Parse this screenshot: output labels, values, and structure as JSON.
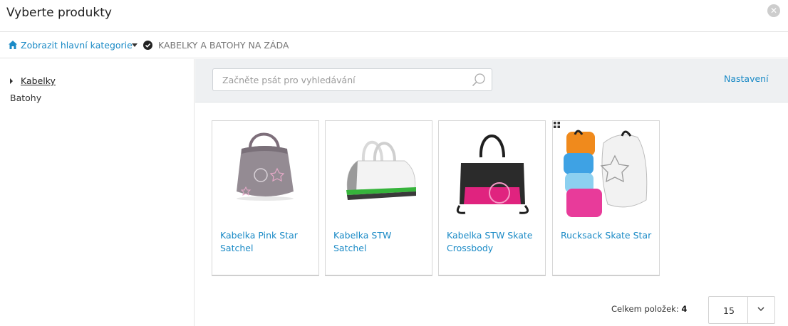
{
  "dialog": {
    "title": "Vyberte produkty",
    "close_icon": "close-icon"
  },
  "breadcrumb": {
    "home_icon": "home-icon",
    "link_label": "Zobrazit hlavní kategorie",
    "caret_icon": "caret-down-icon",
    "check_icon": "check-circle-icon",
    "current": "KABELKY A BATOHY NA ZÁDA"
  },
  "sidebar": {
    "items": [
      {
        "label": "Kabelky",
        "expandable": true
      },
      {
        "label": "Batohy",
        "expandable": false
      }
    ]
  },
  "toolbar": {
    "search_placeholder": "Začněte psát pro vyhledávání",
    "search_value": "",
    "settings_label": "Nastavení"
  },
  "products": [
    {
      "name": "Kabelka Pink Star Satchel"
    },
    {
      "name": "Kabelka STW Satchel"
    },
    {
      "name": "Kabelka STW Skate Crossbody"
    },
    {
      "name": "Rucksack Skate Star"
    }
  ],
  "footer": {
    "total_label": "Celkem položek:",
    "total_count": "4",
    "per_page_value": "15"
  },
  "colors": {
    "link": "#1a8ac6",
    "toolbar_bg": "#eef0f2"
  }
}
